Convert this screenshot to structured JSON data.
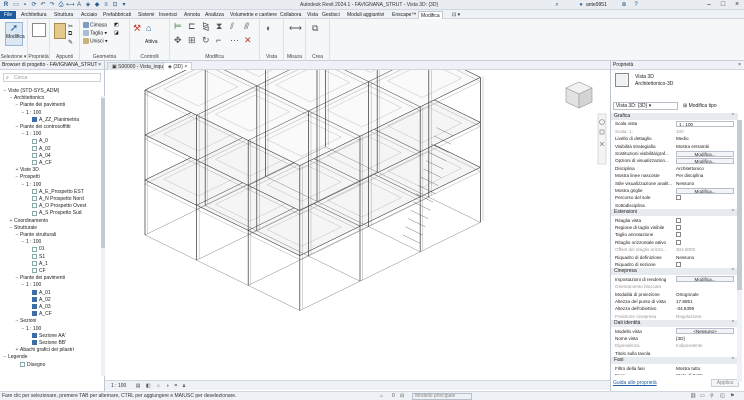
{
  "title": "Autodesk Revit 2024.1 - FAVIGNANA_STRUT - Vista 3D: {3D}",
  "user": "ante9951",
  "menu": [
    "File",
    "Architettura",
    "Struttura",
    "Acciaio",
    "Prefabbricati",
    "Sistemi",
    "Inserisci",
    "Annota",
    "Analizza",
    "Volumetrie e cantiere",
    "Collabora",
    "Vista",
    "Gestisci",
    "Moduli aggiuntivi",
    "Enscape™",
    "Modifica"
  ],
  "ribbon": {
    "select_label": "Selezione ▾",
    "modify_label": "Modifica",
    "properties_label": "Proprietà",
    "clipboard_label": "Appunti",
    "geometry_label": "Geometria",
    "controls_label": "Controlli",
    "modify_group_label": "Modifica",
    "view_label": "Vista",
    "measure_label": "Misura",
    "create_label": "Crea",
    "cut_label": "Cimasa",
    "cut2_label": "Taglia",
    "join_label": "Unisci",
    "activate_label": "Attiva"
  },
  "view_tabs": [
    "S00000 - Vista_inquad",
    "{3D}"
  ],
  "browser": {
    "header": "Browser di progetto - FAVIGNANA_STRUT",
    "search_placeholder": "Cerca",
    "items": [
      {
        "t": "−",
        "icon": "",
        "label": "Viste (STD-SYS_ADM)",
        "lvl": 0
      },
      {
        "t": "−",
        "icon": "",
        "label": "Architettonico",
        "lvl": 1
      },
      {
        "t": "−",
        "icon": "",
        "label": "Piante dei pavimenti",
        "lvl": 2
      },
      {
        "t": "−",
        "icon": "",
        "label": "1 : 100",
        "lvl": 3
      },
      {
        "t": "",
        "icon": "f",
        "label": "A_ZZ_Planimetria",
        "lvl": 4
      },
      {
        "t": "−",
        "icon": "",
        "label": "Piante dei controsoffitti",
        "lvl": 2
      },
      {
        "t": "−",
        "icon": "",
        "label": "1 : 100",
        "lvl": 3
      },
      {
        "t": "",
        "icon": "o",
        "label": "A_0",
        "lvl": 4
      },
      {
        "t": "",
        "icon": "o",
        "label": "A_02",
        "lvl": 4
      },
      {
        "t": "",
        "icon": "o",
        "label": "A_04",
        "lvl": 4
      },
      {
        "t": "",
        "icon": "o",
        "label": "A_CF",
        "lvl": 4
      },
      {
        "t": "+",
        "icon": "",
        "label": "Viste 3D",
        "lvl": 2
      },
      {
        "t": "−",
        "icon": "",
        "label": "Prospetti",
        "lvl": 2
      },
      {
        "t": "−",
        "icon": "",
        "label": "1 : 100",
        "lvl": 3
      },
      {
        "t": "",
        "icon": "o",
        "label": "A_E_Prospetto EST",
        "lvl": 4
      },
      {
        "t": "",
        "icon": "o",
        "label": "A_N Prospetto Nord",
        "lvl": 4
      },
      {
        "t": "",
        "icon": "o",
        "label": "A_O Prospetto Ovest",
        "lvl": 4
      },
      {
        "t": "",
        "icon": "o",
        "label": "A_S Prospetto Sud",
        "lvl": 4
      },
      {
        "t": "+",
        "icon": "",
        "label": "Coordinamento",
        "lvl": 1
      },
      {
        "t": "−",
        "icon": "",
        "label": "Strutturale",
        "lvl": 1
      },
      {
        "t": "−",
        "icon": "",
        "label": "Piante strutturali",
        "lvl": 2
      },
      {
        "t": "−",
        "icon": "",
        "label": "1 : 100",
        "lvl": 3
      },
      {
        "t": "",
        "icon": "o",
        "label": "01",
        "lvl": 4
      },
      {
        "t": "",
        "icon": "o",
        "label": "S1",
        "lvl": 4
      },
      {
        "t": "",
        "icon": "o",
        "label": "A_1",
        "lvl": 4
      },
      {
        "t": "",
        "icon": "o",
        "label": "CF",
        "lvl": 4
      },
      {
        "t": "−",
        "icon": "",
        "label": "Piante dei pavimenti",
        "lvl": 2
      },
      {
        "t": "−",
        "icon": "",
        "label": "1 : 100",
        "lvl": 3
      },
      {
        "t": "",
        "icon": "f",
        "label": "A_01",
        "lvl": 4
      },
      {
        "t": "",
        "icon": "f",
        "label": "A_02",
        "lvl": 4
      },
      {
        "t": "",
        "icon": "f",
        "label": "A_03",
        "lvl": 4
      },
      {
        "t": "",
        "icon": "f",
        "label": "A_CF",
        "lvl": 4
      },
      {
        "t": "−",
        "icon": "",
        "label": "Sezioni",
        "lvl": 2
      },
      {
        "t": "−",
        "icon": "",
        "label": "1 : 100",
        "lvl": 3
      },
      {
        "t": "",
        "icon": "f",
        "label": "Sezione AA'",
        "lvl": 4
      },
      {
        "t": "",
        "icon": "f",
        "label": "Sezione BB'",
        "lvl": 4
      },
      {
        "t": "+",
        "icon": "",
        "label": "Abachi grafici dei pilastri",
        "lvl": 2
      },
      {
        "t": "−",
        "icon": "",
        "label": "Legende",
        "lvl": 0
      },
      {
        "t": "",
        "icon": "o",
        "label": "Disegno",
        "lvl": 2
      }
    ]
  },
  "viewport": {
    "scale": "1 : 100",
    "zoom": "0",
    "model": "Modello principale",
    "nav_cube_label": "SUD"
  },
  "properties": {
    "header": "Proprietà",
    "type_name": "Vista 3D",
    "type_sub": "Architettonico-3D",
    "selector": "Vista 3D: {3D}",
    "edit_type": "Modifica tipo",
    "help_link": "Guida alle proprietà",
    "apply_label": "Applica",
    "rows": [
      {
        "sec": "Grafica"
      },
      {
        "k": "Scala vista",
        "v": "1 : 100",
        "kind": "inp"
      },
      {
        "k": "Scala: 1:",
        "v": "100",
        "kind": "dim"
      },
      {
        "k": "Livello di dettaglio",
        "v": "Medio"
      },
      {
        "k": "Visibilità strategiafia",
        "v": "Mostra entrambi"
      },
      {
        "k": "Sostituzioni visibilità/graf...",
        "v": "Modifica...",
        "kind": "btn"
      },
      {
        "k": "Opzioni di visualizzazion...",
        "v": "Modifica...",
        "kind": "btn"
      },
      {
        "k": "Disciplina",
        "v": "Architettonico"
      },
      {
        "k": "Mostra linee nascoste",
        "v": "Per disciplina"
      },
      {
        "k": "Stile visualizzazione analit...",
        "v": "Nessuno"
      },
      {
        "k": "Mostra griglie",
        "v": "Modifica...",
        "kind": "btn"
      },
      {
        "k": "Percorso del sole",
        "v": "",
        "kind": "cb"
      },
      {
        "k": "Sottodisciplina",
        "v": ""
      },
      {
        "sec": "Estensioni"
      },
      {
        "k": "Ritaglia vista",
        "v": "",
        "kind": "cb"
      },
      {
        "k": "Regione di taglio visibile",
        "v": "",
        "kind": "cb"
      },
      {
        "k": "Taglio annotazione",
        "v": "",
        "kind": "cb"
      },
      {
        "k": "Ritaglio orizzontale attivo",
        "v": "",
        "kind": "cb"
      },
      {
        "k": "Offset del ritaglio orizzo...",
        "v": "304.8000",
        "kind": "dim"
      },
      {
        "k": "Riquadro di definizione",
        "v": "Nessuno"
      },
      {
        "k": "Riquadro di sezione",
        "v": "",
        "kind": "cb"
      },
      {
        "sec": "Cinepresa"
      },
      {
        "k": "Impostazioni di rendering",
        "v": "Modifica...",
        "kind": "btn"
      },
      {
        "k": "Orientamento bloccato",
        "v": "",
        "kind": "dim"
      },
      {
        "k": "Modalità di proiezione",
        "v": "Ortogonale"
      },
      {
        "k": "Altezza del punto di vista",
        "v": "17.8851"
      },
      {
        "k": "Altezza dell'obiettivo",
        "v": "-34.6395"
      },
      {
        "k": "Posizione cinepresa",
        "v": "Regolazione",
        "kind": "dim"
      },
      {
        "sec": "Dati identità"
      },
      {
        "k": "Modello vista",
        "v": "<Nessuno>",
        "kind": "btn"
      },
      {
        "k": "Nome vista",
        "v": "{3D}"
      },
      {
        "k": "Dipendenza",
        "v": "Indipendente",
        "kind": "dim"
      },
      {
        "k": "Titolo sulla tavola",
        "v": ""
      },
      {
        "sec": "Fasi"
      },
      {
        "k": "Filtro della fasi",
        "v": "Mostra tutto"
      },
      {
        "k": "Fase",
        "v": "Stato di Fatto"
      }
    ]
  },
  "status": "Fare clic per selezionare, premere TAB per alternare, CTRL per aggiungere e MAIUSC per deselezionare."
}
